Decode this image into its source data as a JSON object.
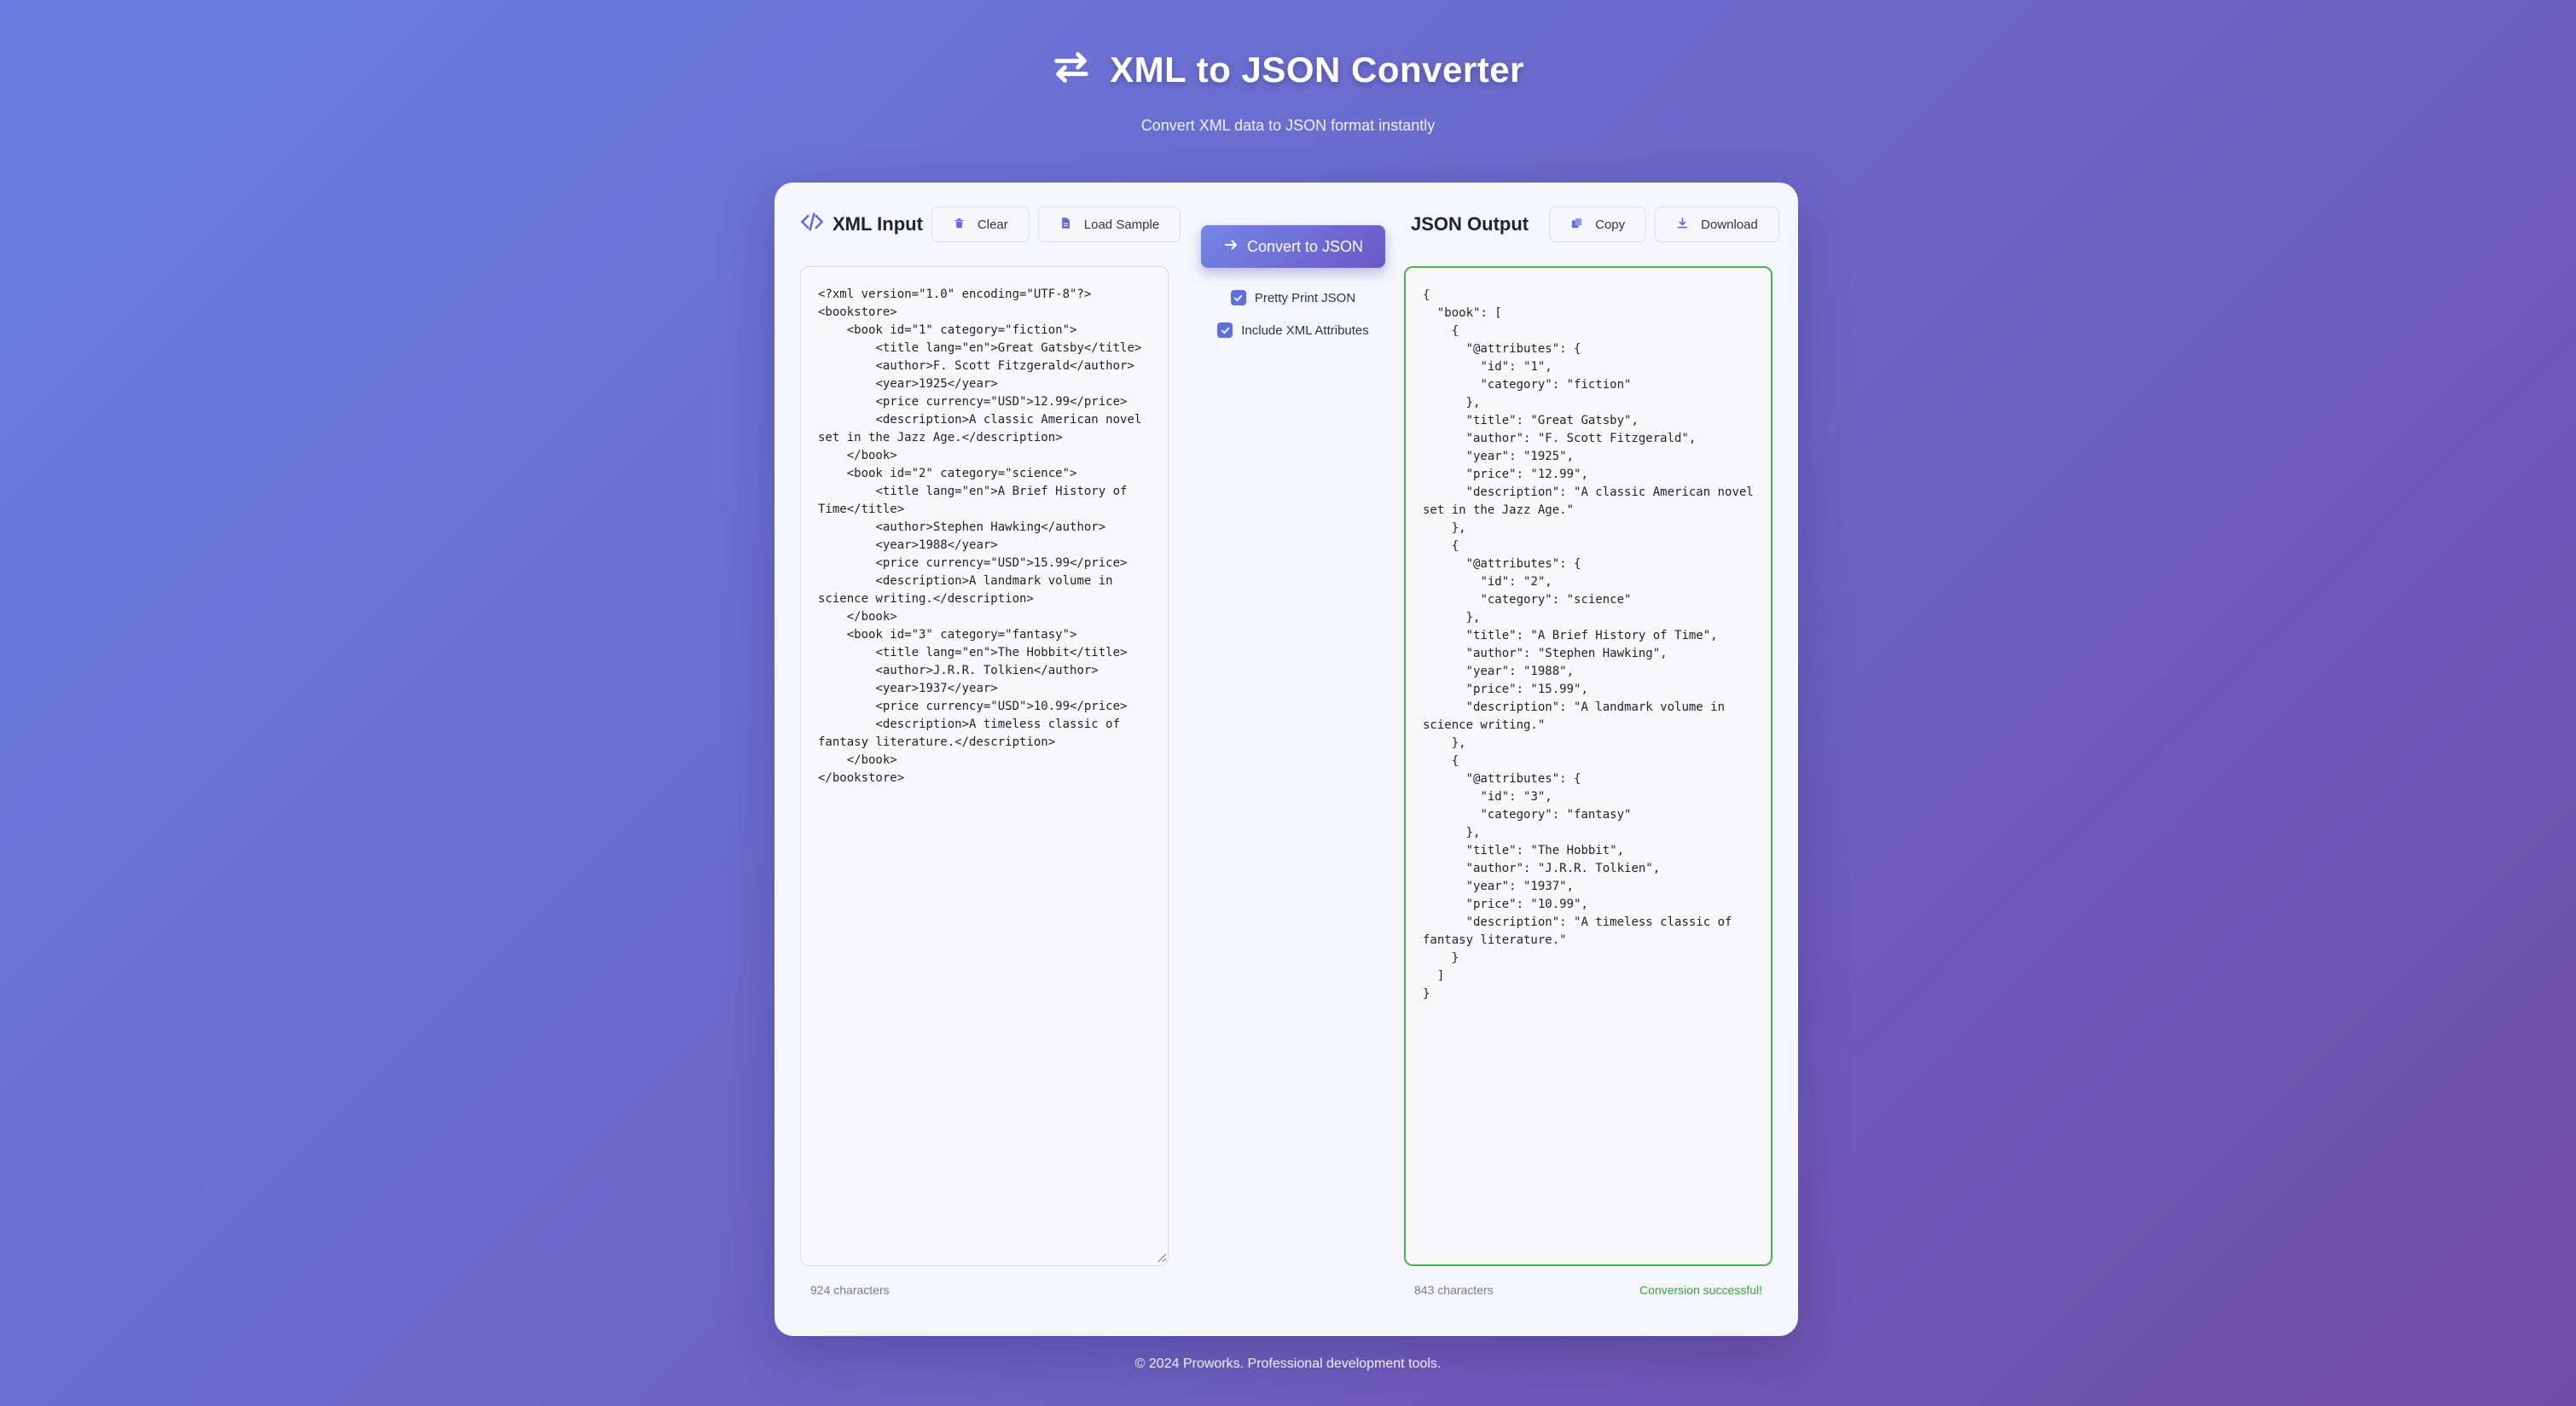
{
  "header": {
    "title": "XML to JSON Converter",
    "subtitle": "Convert XML data to JSON format instantly",
    "icon": "swap-arrows-icon"
  },
  "input_panel": {
    "title": "XML Input",
    "clear_label": "Clear",
    "load_sample_label": "Load Sample",
    "content": "<?xml version=\"1.0\" encoding=\"UTF-8\"?>\n<bookstore>\n    <book id=\"1\" category=\"fiction\">\n        <title lang=\"en\">Great Gatsby</title>\n        <author>F. Scott Fitzgerald</author>\n        <year>1925</year>\n        <price currency=\"USD\">12.99</price>\n        <description>A classic American novel set in the Jazz Age.</description>\n    </book>\n    <book id=\"2\" category=\"science\">\n        <title lang=\"en\">A Brief History of Time</title>\n        <author>Stephen Hawking</author>\n        <year>1988</year>\n        <price currency=\"USD\">15.99</price>\n        <description>A landmark volume in science writing.</description>\n    </book>\n    <book id=\"3\" category=\"fantasy\">\n        <title lang=\"en\">The Hobbit</title>\n        <author>J.R.R. Tolkien</author>\n        <year>1937</year>\n        <price currency=\"USD\">10.99</price>\n        <description>A timeless classic of fantasy literature.</description>\n    </book>\n</bookstore>",
    "char_count": "924 characters"
  },
  "controls": {
    "convert_label": "Convert to JSON",
    "pretty_print_label": "Pretty Print JSON",
    "pretty_print_checked": true,
    "include_attributes_label": "Include XML Attributes",
    "include_attributes_checked": true
  },
  "output_panel": {
    "title": "JSON Output",
    "copy_label": "Copy",
    "download_label": "Download",
    "content": "{\n  \"book\": [\n    {\n      \"@attributes\": {\n        \"id\": \"1\",\n        \"category\": \"fiction\"\n      },\n      \"title\": \"Great Gatsby\",\n      \"author\": \"F. Scott Fitzgerald\",\n      \"year\": \"1925\",\n      \"price\": \"12.99\",\n      \"description\": \"A classic American novel set in the Jazz Age.\"\n    },\n    {\n      \"@attributes\": {\n        \"id\": \"2\",\n        \"category\": \"science\"\n      },\n      \"title\": \"A Brief History of Time\",\n      \"author\": \"Stephen Hawking\",\n      \"year\": \"1988\",\n      \"price\": \"15.99\",\n      \"description\": \"A landmark volume in science writing.\"\n    },\n    {\n      \"@attributes\": {\n        \"id\": \"3\",\n        \"category\": \"fantasy\"\n      },\n      \"title\": \"The Hobbit\",\n      \"author\": \"J.R.R. Tolkien\",\n      \"year\": \"1937\",\n      \"price\": \"10.99\",\n      \"description\": \"A timeless classic of fantasy literature.\"\n    }\n  ]\n}",
    "char_count": "843 characters",
    "status": "Conversion successful!"
  },
  "footer": {
    "copyright": "© 2024 Proworks. Professional development tools."
  },
  "colors": {
    "accent": "#5d6fe0",
    "success": "#3aa13f",
    "gradient_start": "#6a7fe3",
    "gradient_end": "#6f4da6"
  }
}
